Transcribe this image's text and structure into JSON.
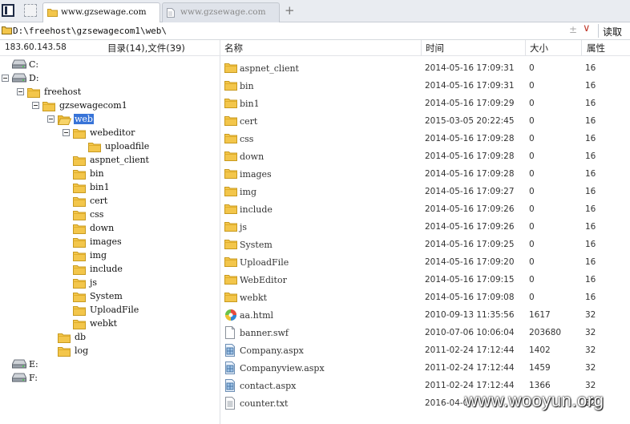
{
  "tabs": [
    {
      "title": "www.gzsewage.com",
      "active": true
    },
    {
      "title": "www.gzsewage.com",
      "active": false
    }
  ],
  "address": {
    "path": "D:\\freehost\\gzsewagecom1\\web\\",
    "read_label": "读取"
  },
  "info": {
    "ip": "183.60.143.58",
    "counts": "目录(14),文件(39)"
  },
  "columns": {
    "name": "名称",
    "time": "时间",
    "size": "大小",
    "attr": "属性"
  },
  "tree": [
    {
      "label": "C:",
      "type": "drive",
      "level": 0,
      "expander": false,
      "selected": false
    },
    {
      "label": "D:",
      "type": "drive",
      "level": 0,
      "expander": true,
      "selected": false
    },
    {
      "label": "freehost",
      "type": "folder",
      "level": 1,
      "expander": true,
      "selected": false
    },
    {
      "label": "gzsewagecom1",
      "type": "folder",
      "level": 2,
      "expander": true,
      "selected": false
    },
    {
      "label": "web",
      "type": "folder-open",
      "level": 3,
      "expander": true,
      "selected": true
    },
    {
      "label": "webeditor",
      "type": "folder",
      "level": 4,
      "expander": true,
      "selected": false
    },
    {
      "label": "uploadfile",
      "type": "folder",
      "level": 5,
      "expander": false,
      "selected": false
    },
    {
      "label": "aspnet_client",
      "type": "folder",
      "level": 4,
      "expander": false,
      "selected": false
    },
    {
      "label": "bin",
      "type": "folder",
      "level": 4,
      "expander": false,
      "selected": false
    },
    {
      "label": "bin1",
      "type": "folder",
      "level": 4,
      "expander": false,
      "selected": false
    },
    {
      "label": "cert",
      "type": "folder",
      "level": 4,
      "expander": false,
      "selected": false
    },
    {
      "label": "css",
      "type": "folder",
      "level": 4,
      "expander": false,
      "selected": false
    },
    {
      "label": "down",
      "type": "folder",
      "level": 4,
      "expander": false,
      "selected": false
    },
    {
      "label": "images",
      "type": "folder",
      "level": 4,
      "expander": false,
      "selected": false
    },
    {
      "label": "img",
      "type": "folder",
      "level": 4,
      "expander": false,
      "selected": false
    },
    {
      "label": "include",
      "type": "folder",
      "level": 4,
      "expander": false,
      "selected": false
    },
    {
      "label": "js",
      "type": "folder",
      "level": 4,
      "expander": false,
      "selected": false
    },
    {
      "label": "System",
      "type": "folder",
      "level": 4,
      "expander": false,
      "selected": false
    },
    {
      "label": "UploadFile",
      "type": "folder",
      "level": 4,
      "expander": false,
      "selected": false
    },
    {
      "label": "webkt",
      "type": "folder",
      "level": 4,
      "expander": false,
      "selected": false
    },
    {
      "label": "db",
      "type": "folder",
      "level": 3,
      "expander": false,
      "selected": false
    },
    {
      "label": "log",
      "type": "folder",
      "level": 3,
      "expander": false,
      "selected": false
    },
    {
      "label": "E:",
      "type": "drive",
      "level": 0,
      "expander": false,
      "selected": false
    },
    {
      "label": "F:",
      "type": "drive",
      "level": 0,
      "expander": false,
      "selected": false
    }
  ],
  "files": [
    {
      "name": "aspnet_client",
      "time": "2014-05-16 17:09:31",
      "size": "0",
      "attr": "16",
      "icon": "folder"
    },
    {
      "name": "bin",
      "time": "2014-05-16 17:09:31",
      "size": "0",
      "attr": "16",
      "icon": "folder"
    },
    {
      "name": "bin1",
      "time": "2014-05-16 17:09:29",
      "size": "0",
      "attr": "16",
      "icon": "folder"
    },
    {
      "name": "cert",
      "time": "2015-03-05 20:22:45",
      "size": "0",
      "attr": "16",
      "icon": "folder"
    },
    {
      "name": "css",
      "time": "2014-05-16 17:09:28",
      "size": "0",
      "attr": "16",
      "icon": "folder"
    },
    {
      "name": "down",
      "time": "2014-05-16 17:09:28",
      "size": "0",
      "attr": "16",
      "icon": "folder"
    },
    {
      "name": "images",
      "time": "2014-05-16 17:09:28",
      "size": "0",
      "attr": "16",
      "icon": "folder"
    },
    {
      "name": "img",
      "time": "2014-05-16 17:09:27",
      "size": "0",
      "attr": "16",
      "icon": "folder"
    },
    {
      "name": "include",
      "time": "2014-05-16 17:09:26",
      "size": "0",
      "attr": "16",
      "icon": "folder"
    },
    {
      "name": "js",
      "time": "2014-05-16 17:09:26",
      "size": "0",
      "attr": "16",
      "icon": "folder"
    },
    {
      "name": "System",
      "time": "2014-05-16 17:09:25",
      "size": "0",
      "attr": "16",
      "icon": "folder"
    },
    {
      "name": "UploadFile",
      "time": "2014-05-16 17:09:20",
      "size": "0",
      "attr": "16",
      "icon": "folder"
    },
    {
      "name": "WebEditor",
      "time": "2014-05-16 17:09:15",
      "size": "0",
      "attr": "16",
      "icon": "folder"
    },
    {
      "name": "webkt",
      "time": "2014-05-16 17:09:08",
      "size": "0",
      "attr": "16",
      "icon": "folder"
    },
    {
      "name": "aa.html",
      "time": "2010-09-13 11:35:56",
      "size": "1617",
      "attr": "32",
      "icon": "html"
    },
    {
      "name": "banner.swf",
      "time": "2010-07-06 10:06:04",
      "size": "203680",
      "attr": "32",
      "icon": "blank"
    },
    {
      "name": "Company.aspx",
      "time": "2011-02-24 17:12:44",
      "size": "1402",
      "attr": "32",
      "icon": "aspx"
    },
    {
      "name": "Companyview.aspx",
      "time": "2011-02-24 17:12:44",
      "size": "1459",
      "attr": "32",
      "icon": "aspx"
    },
    {
      "name": "contact.aspx",
      "time": "2011-02-24 17:12:44",
      "size": "1366",
      "attr": "32",
      "icon": "aspx"
    },
    {
      "name": "counter.txt",
      "time": "2016-04-0",
      "size": "",
      "attr": "32",
      "icon": "txt"
    }
  ],
  "watermark": "www.wooyun.org",
  "colors": {
    "selection": "#3874d8",
    "folder": "#f3c64b",
    "dropdown_arrow": "#c0392b"
  }
}
